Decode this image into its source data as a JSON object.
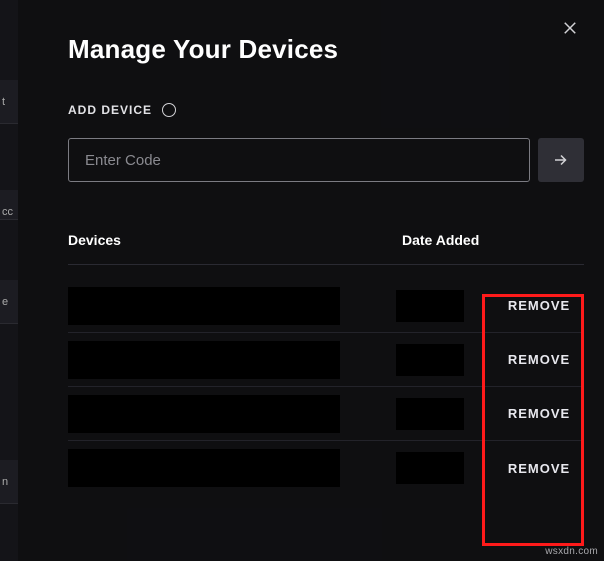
{
  "dialog": {
    "title": "Manage Your Devices",
    "add_label": "ADD DEVICE",
    "code_placeholder": "Enter Code"
  },
  "table": {
    "head_devices": "Devices",
    "head_date": "Date Added",
    "remove_label": "REMOVE",
    "rows": [
      {
        "device": "",
        "date": ""
      },
      {
        "device": "",
        "date": ""
      },
      {
        "device": "",
        "date": ""
      },
      {
        "device": "",
        "date": ""
      }
    ]
  },
  "bg": {
    "items": [
      "t",
      "cc",
      "e",
      "n"
    ]
  },
  "watermark": "wsxdn.com"
}
